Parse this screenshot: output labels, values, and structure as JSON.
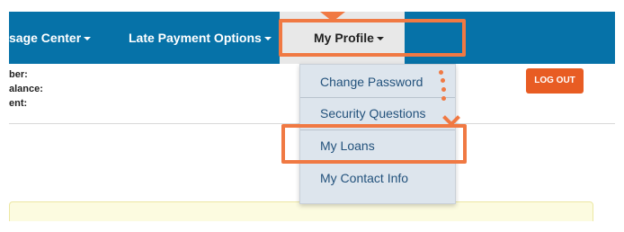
{
  "nav": {
    "message_center": "sage Center",
    "late_payment_options": "Late Payment Options",
    "my_profile": "My Profile"
  },
  "account_info": {
    "labels": [
      "ber:",
      "alance:",
      "ent:"
    ]
  },
  "logout": {
    "label": "LOG OUT"
  },
  "profile_menu": {
    "items": [
      {
        "label": "Change Password"
      },
      {
        "label": "Security Questions"
      },
      {
        "label": "My Loans",
        "highlighted": true
      },
      {
        "label": "My Contact Info"
      }
    ]
  },
  "colors": {
    "navbar": "#0672a8",
    "highlight": "#f07943",
    "logout": "#e85c23",
    "menu_bg": "#dde5ed",
    "link": "#23527c",
    "notice_bg": "#fcfbe0"
  }
}
